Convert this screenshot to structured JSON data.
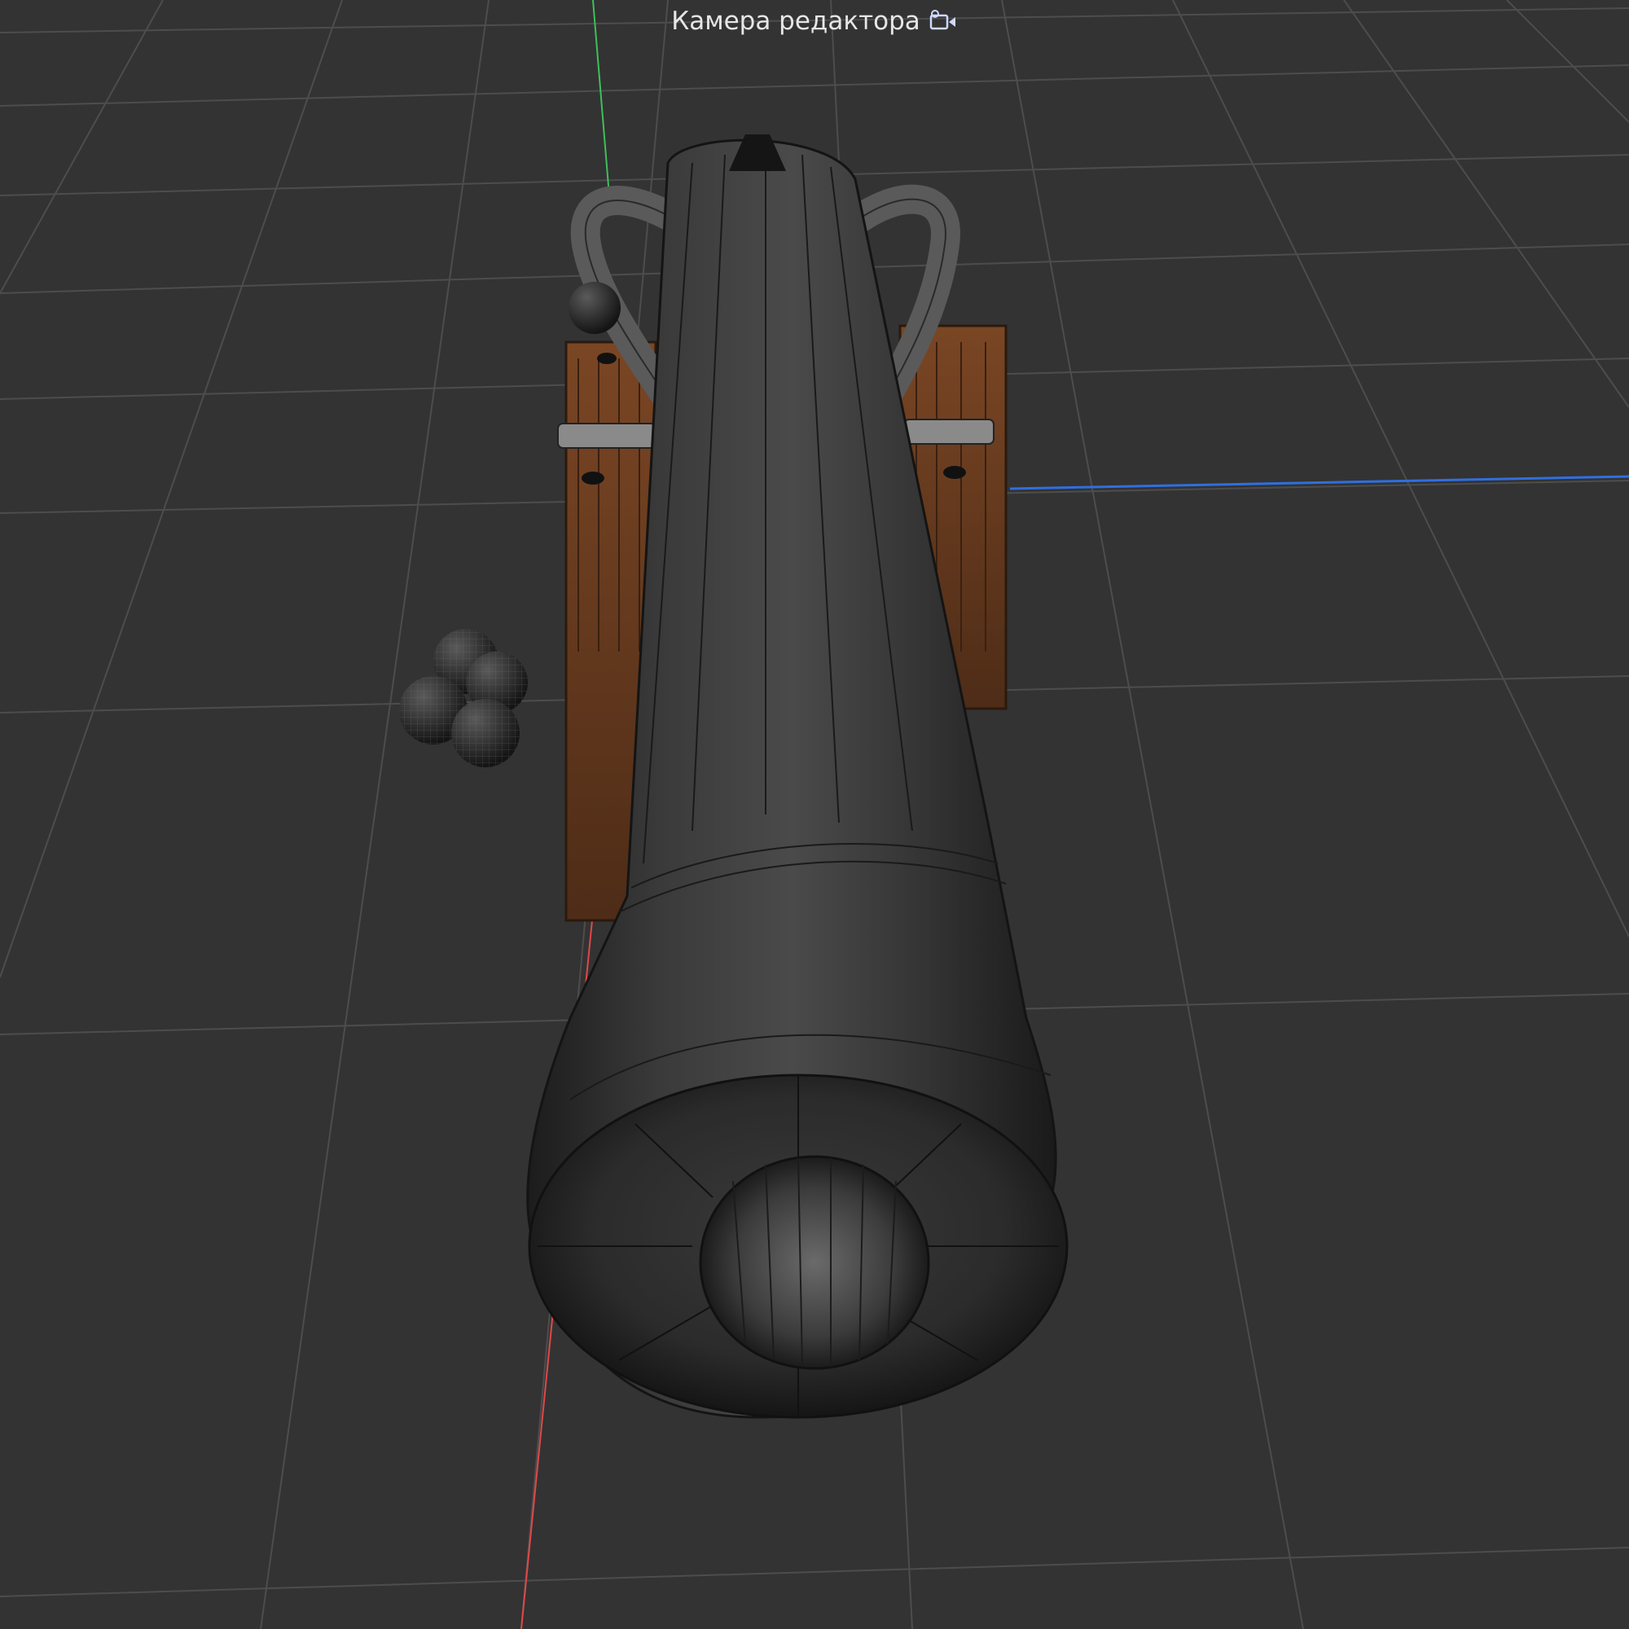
{
  "viewport": {
    "camera_label": "Камера редактора",
    "camera_icon": "video-camera-icon",
    "background_color": "#333333",
    "grid_color": "#4d4d4d",
    "axis_x_color": "#e04848",
    "axis_y_color": "#3fbf5a",
    "axis_z_color": "#2f6fe0"
  },
  "scene": {
    "objects": [
      {
        "name": "cannon-barrel",
        "material": "dark-iron"
      },
      {
        "name": "cannon-carriage",
        "material": "wood"
      },
      {
        "name": "cannon-balls",
        "count": 4
      }
    ]
  }
}
